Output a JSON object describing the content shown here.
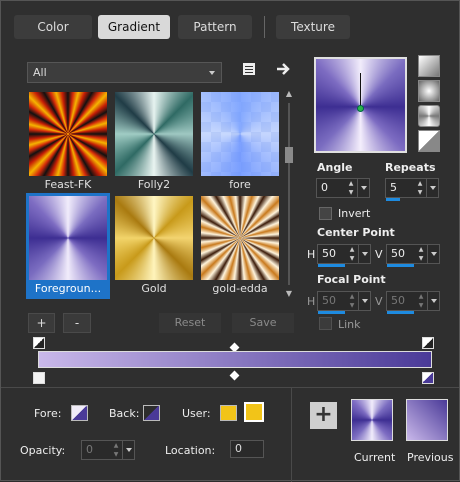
{
  "tabs": [
    {
      "label": "Color"
    },
    {
      "label": "Gradient"
    },
    {
      "label": "Pattern"
    },
    {
      "label": "Texture"
    }
  ],
  "library": {
    "selected": "All",
    "items": [
      {
        "label": "Feast-FK"
      },
      {
        "label": "Folly2"
      },
      {
        "label": "fore"
      },
      {
        "label": "Foregroun..."
      },
      {
        "label": "Gold"
      },
      {
        "label": "gold-edda"
      }
    ],
    "add_label": "+",
    "remove_label": "-",
    "reset_label": "Reset",
    "save_label": "Save"
  },
  "settings": {
    "angle_label": "Angle",
    "angle_value": "0",
    "repeats_label": "Repeats",
    "repeats_value": "5",
    "invert_label": "Invert",
    "center_point_label": "Center Point",
    "center_h_label": "H",
    "center_h_value": "50",
    "center_v_label": "V",
    "center_v_value": "50",
    "focal_point_label": "Focal Point",
    "focal_h_label": "H",
    "focal_h_value": "50",
    "focal_v_label": "V",
    "focal_v_value": "50",
    "link_label": "Link"
  },
  "bottom": {
    "fore_label": "Fore:",
    "back_label": "Back:",
    "user_label": "User:",
    "opacity_label": "Opacity:",
    "opacity_value": "0",
    "location_label": "Location:",
    "location_value": "0",
    "current_label": "Current",
    "previous_label": "Previous"
  },
  "colors": {
    "accent": "#1e73c8",
    "fore": "#c9b8ea",
    "back": "#4a3a98",
    "user": "#f2c418"
  }
}
